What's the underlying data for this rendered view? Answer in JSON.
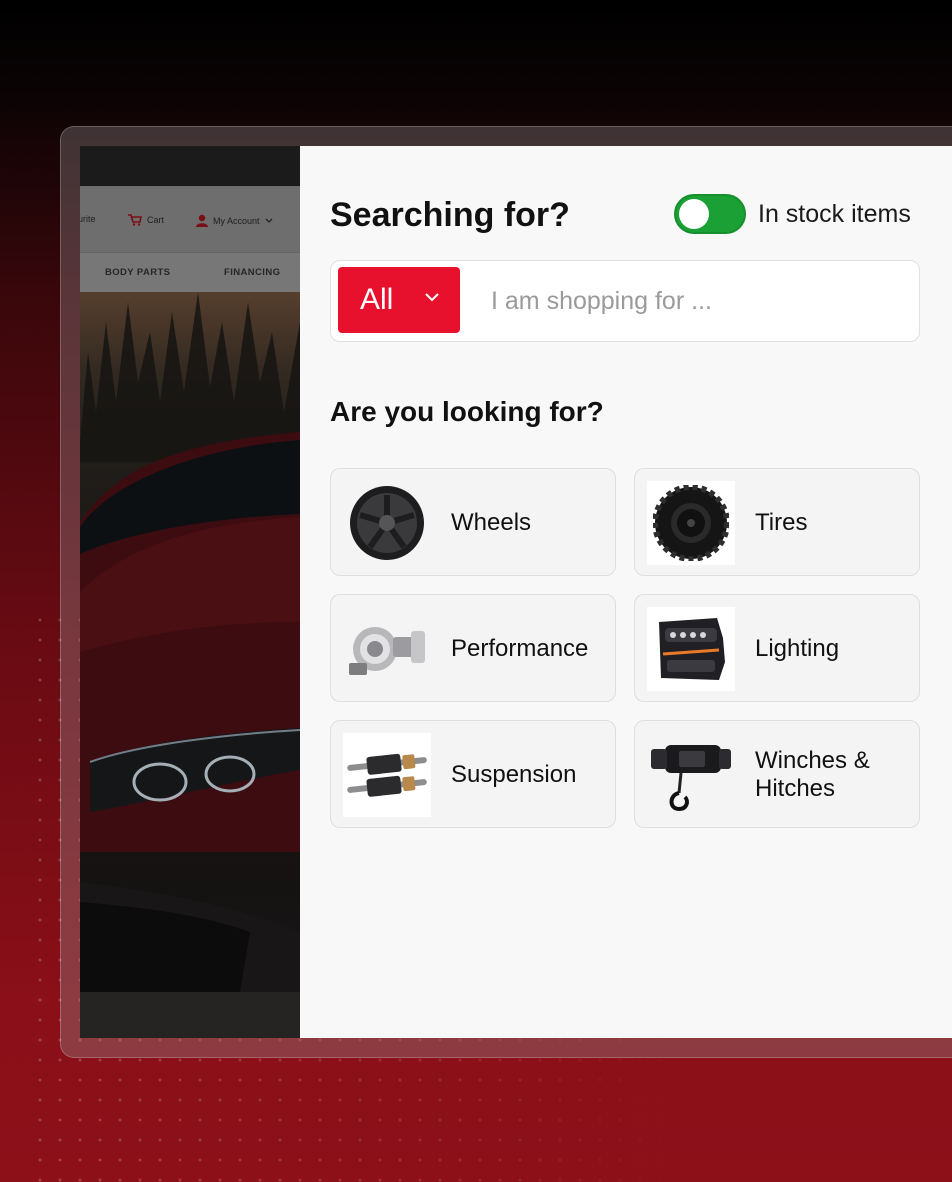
{
  "site": {
    "header": {
      "favourite_label": "urite",
      "cart_label": "Cart",
      "account_label": "My Account"
    },
    "nav": {
      "items": [
        "BODY PARTS",
        "FINANCING"
      ]
    }
  },
  "search_panel": {
    "title": "Searching for?",
    "in_stock_toggle": {
      "label": "In stock items",
      "on": true
    },
    "category_select": {
      "selected": "All"
    },
    "search_input": {
      "placeholder": "I am shopping for ..."
    },
    "suggestions_title": "Are you looking for?",
    "categories": [
      {
        "label": "Wheels",
        "icon": "wheel-image"
      },
      {
        "label": "Tires",
        "icon": "tire-image"
      },
      {
        "label": "Performance",
        "icon": "turbocharger-image"
      },
      {
        "label": "Lighting",
        "icon": "headlight-image"
      },
      {
        "label": "Suspension",
        "icon": "coilover-image"
      },
      {
        "label": "Winches &",
        "label_line2": "Hitches",
        "icon": "winch-image"
      }
    ]
  },
  "colors": {
    "accent_red": "#e8112d",
    "toggle_green": "#1aa034",
    "background_dark_red": "#8a0f18"
  }
}
